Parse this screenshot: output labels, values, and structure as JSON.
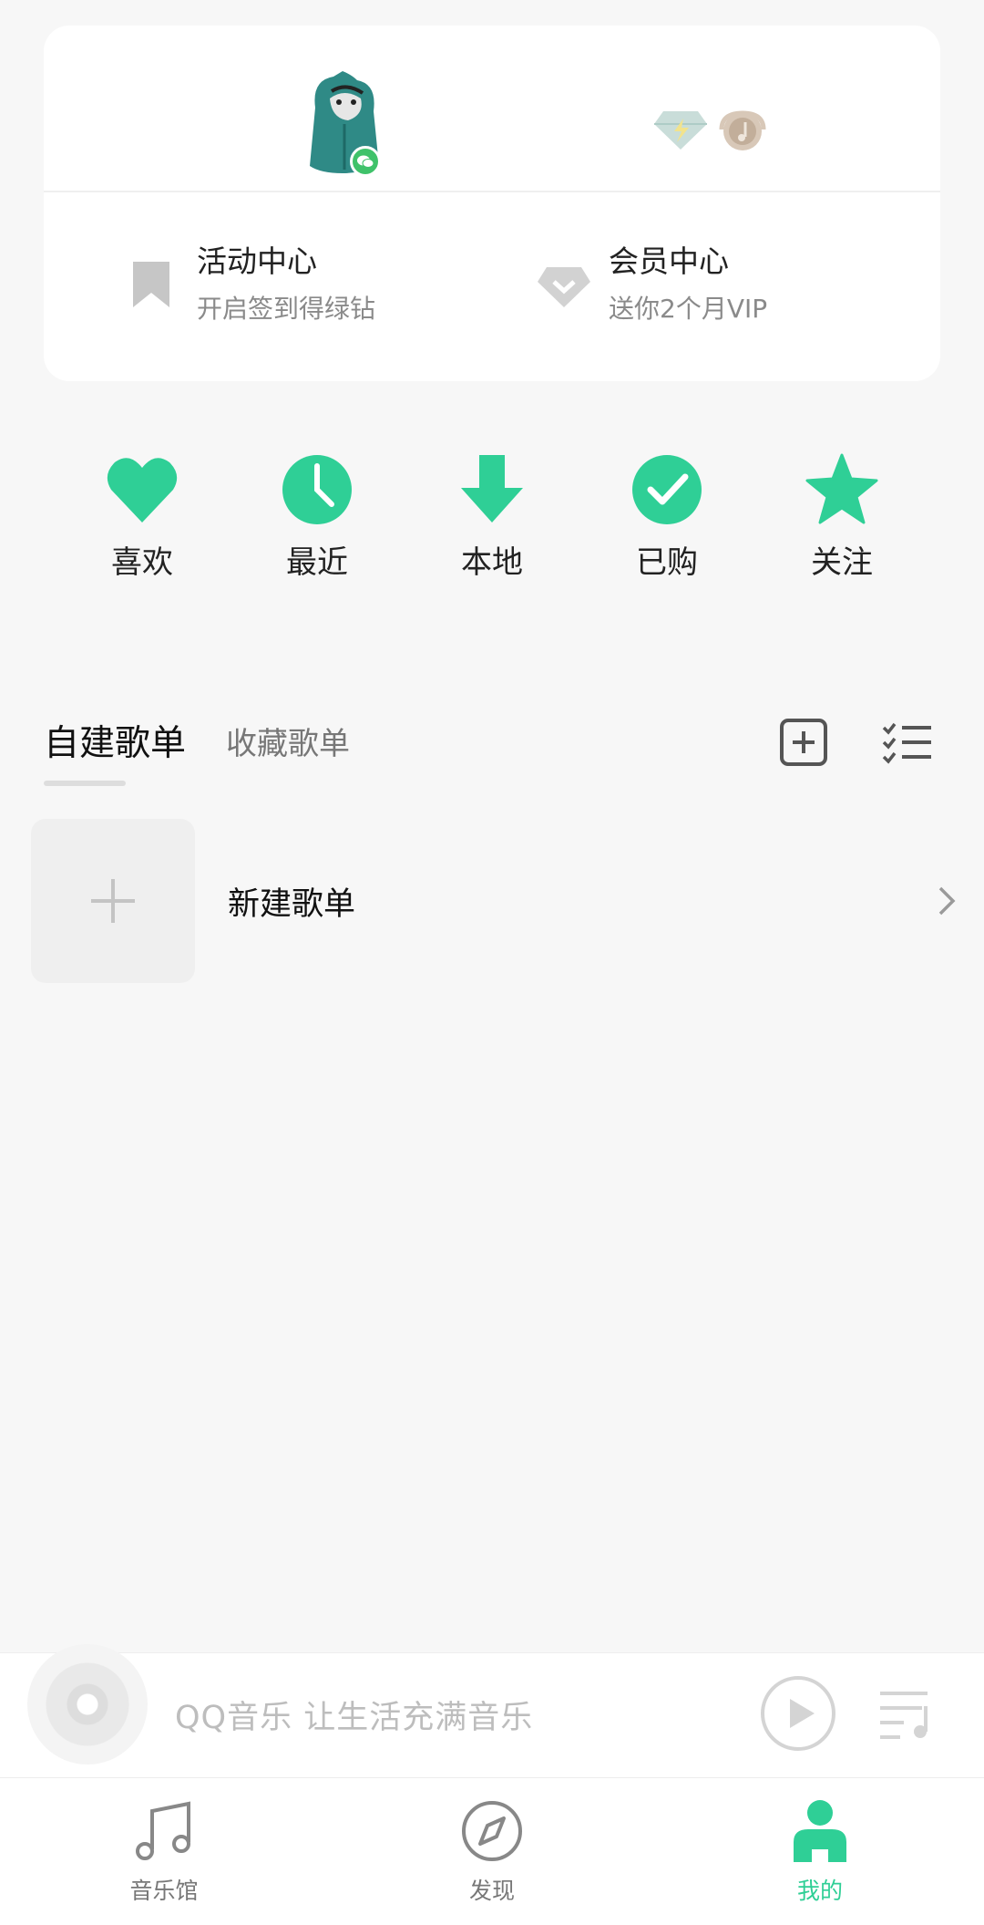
{
  "colors": {
    "accent": "#2fcf96",
    "background": "#f7f7f7",
    "card": "#ffffff",
    "muted_icon": "#c8c8c8"
  },
  "profile": {
    "avatar_icon": "bear-hoodie-avatar",
    "wechat_badge_icon": "wechat-icon",
    "badges": [
      "green-diamond-icon",
      "music-level-icon"
    ]
  },
  "entries": [
    {
      "icon": "bookmark-icon",
      "title": "活动中心",
      "subtitle": "开启签到得绿钻"
    },
    {
      "icon": "diamond-icon",
      "title": "会员中心",
      "subtitle": "送你2个月VIP"
    }
  ],
  "quick_actions": [
    {
      "icon": "heart-icon",
      "label": "喜欢"
    },
    {
      "icon": "clock-icon",
      "label": "最近"
    },
    {
      "icon": "download-icon",
      "label": "本地"
    },
    {
      "icon": "check-circle-icon",
      "label": "已购"
    },
    {
      "icon": "star-icon",
      "label": "关注"
    }
  ],
  "playlist_tabs": {
    "created": "自建歌单",
    "collected": "收藏歌单",
    "active": "created"
  },
  "new_playlist": {
    "label": "新建歌单"
  },
  "mini_player": {
    "text": "QQ音乐 让生活充满音乐"
  },
  "nav": [
    {
      "icon": "music-note-icon",
      "label": "音乐馆",
      "active": false
    },
    {
      "icon": "compass-icon",
      "label": "发现",
      "active": false
    },
    {
      "icon": "person-icon",
      "label": "我的",
      "active": true
    }
  ]
}
